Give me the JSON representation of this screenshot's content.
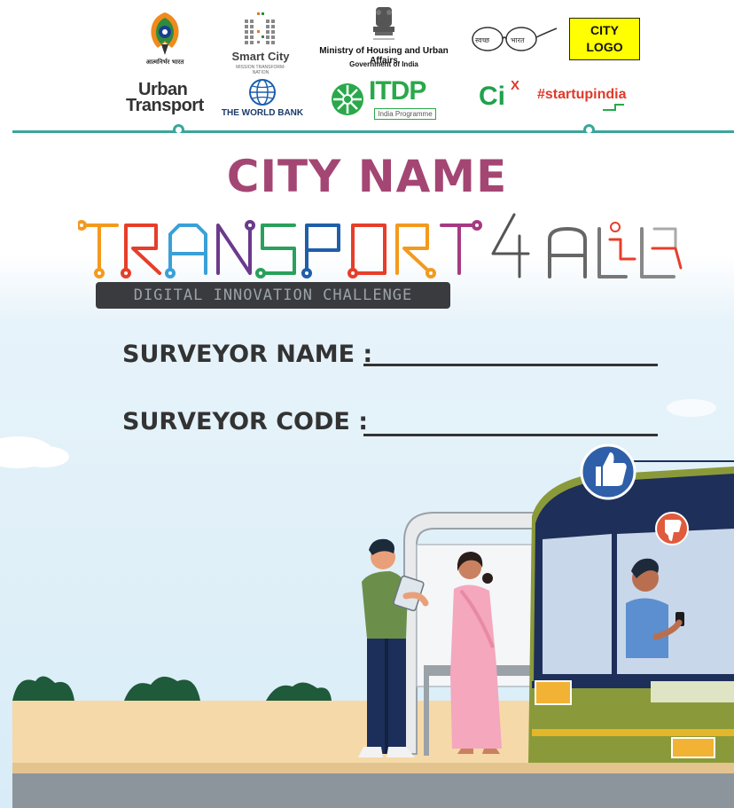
{
  "logos": {
    "aatmanirbhar": "आत्मनिर्भर भारत",
    "smart_city": "Smart City",
    "smart_city_tagline": "MISSION TRANSFORM-NATION",
    "ministry_line1": "Ministry of Housing and Urban Affairs",
    "ministry_line2": "Government of India",
    "swachh_left": "स्वच्छ",
    "swachh_right": "भारत",
    "city_logo": "CITY\nLOGO",
    "urban_line1": "Urban",
    "urban_line2": "Transport",
    "world_bank": "THE WORLD BANK",
    "itdp": "ITDP",
    "itdp_sub": "India Programme",
    "cix": "Ci",
    "cix_sup": "X",
    "startup": "#startupindia"
  },
  "title": {
    "city_name": "CITY NAME",
    "brand_transport": "TRANSPORT",
    "brand_4": "4",
    "brand_all": "ALL",
    "challenge": "DIGITAL INNOVATION CHALLENGE"
  },
  "form": {
    "surveyor_name_label": "SURVEYOR NAME :",
    "surveyor_code_label": "SURVEYOR CODE :"
  },
  "colors": {
    "city_name": "#a44673",
    "divider": "#3aa69a",
    "sky": "#d8ecf7",
    "bus_green": "#8a9a3a"
  }
}
